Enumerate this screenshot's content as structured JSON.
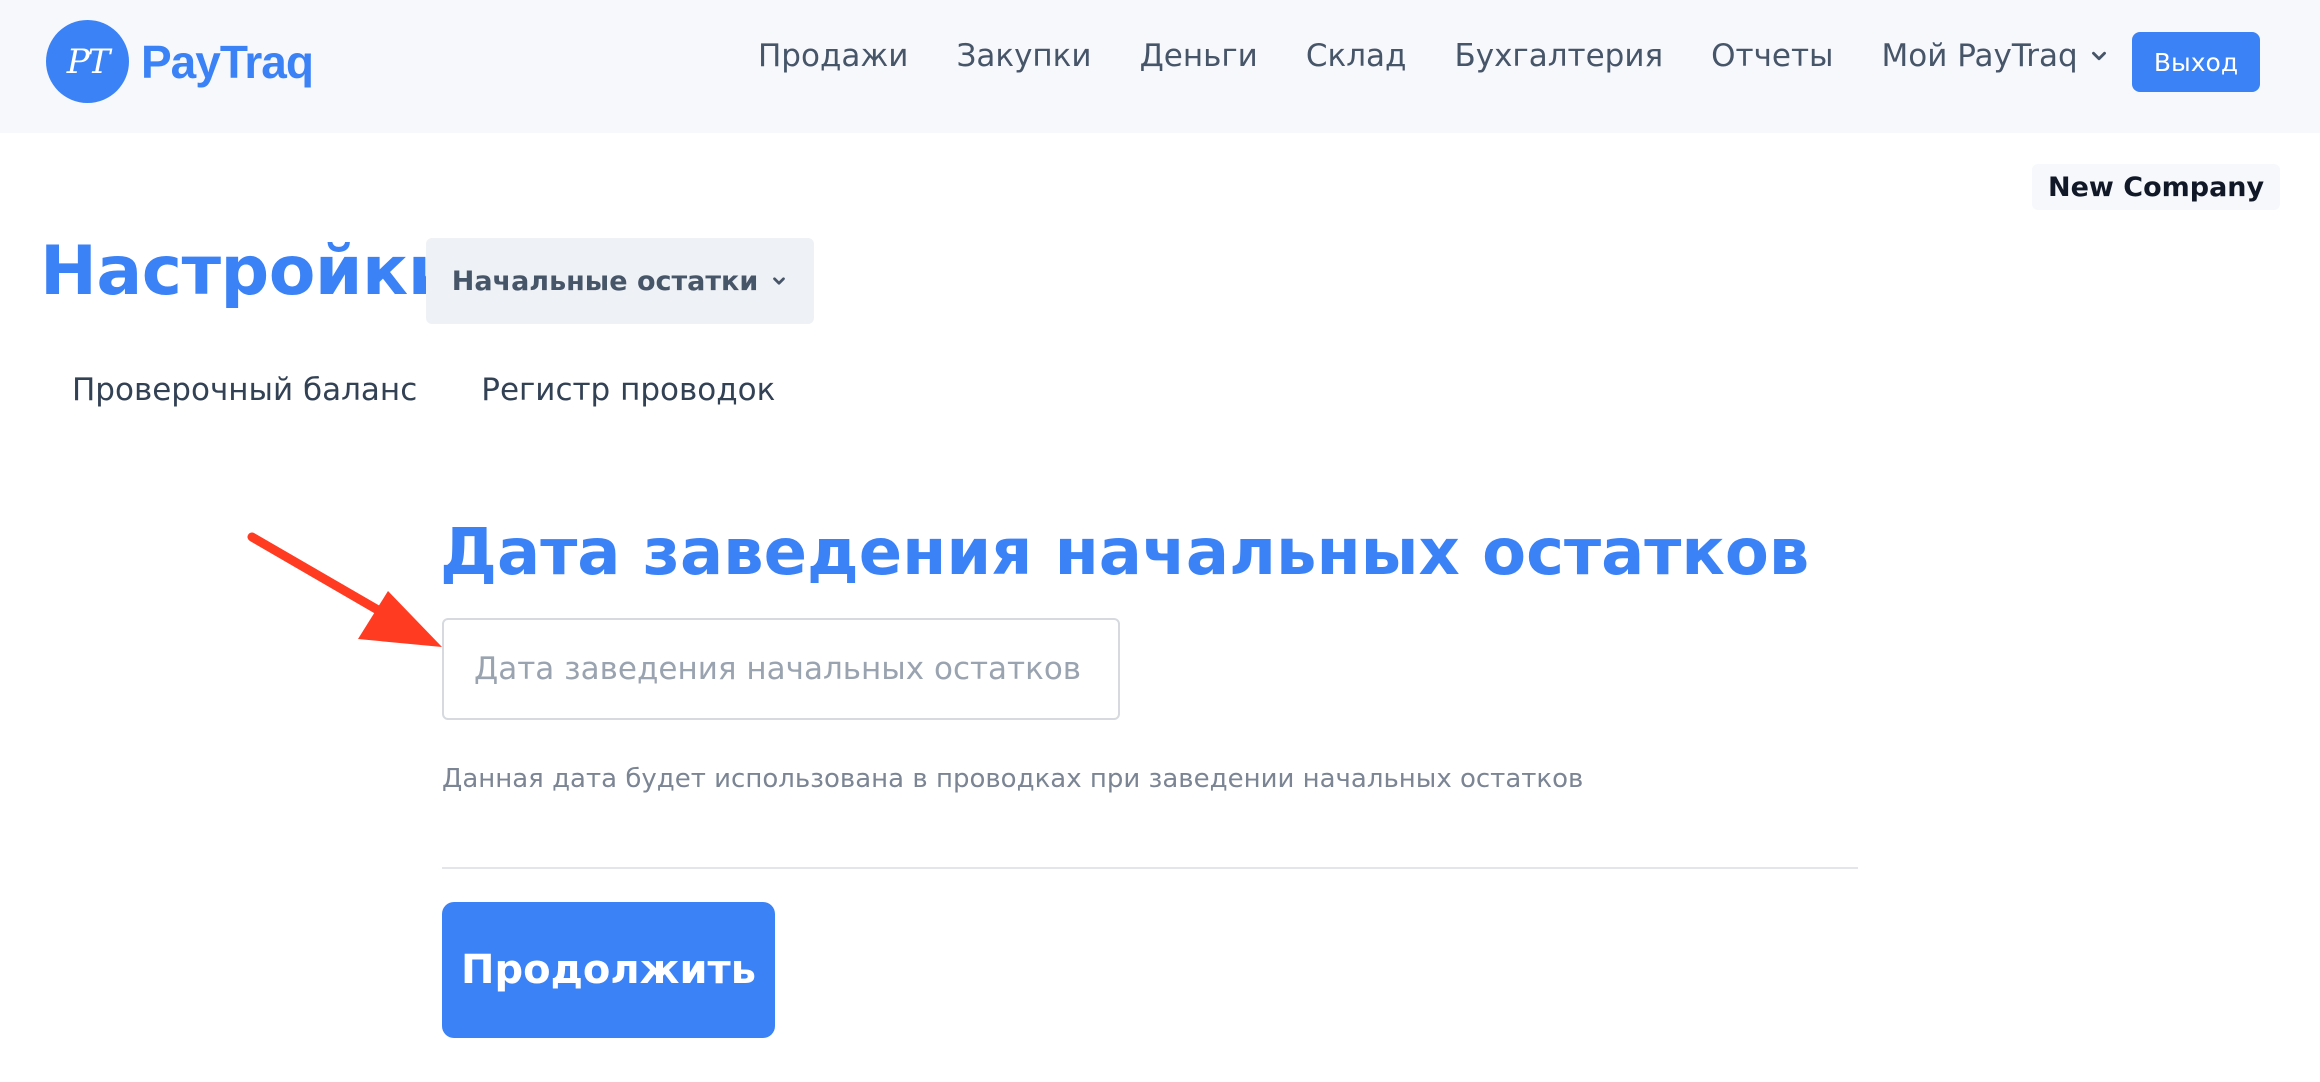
{
  "header": {
    "logo_mark": "PT",
    "logo_text": "PayTraq",
    "nav": [
      "Продажи",
      "Закупки",
      "Деньги",
      "Склад",
      "Бухгалтерия",
      "Отчеты"
    ],
    "nav_dropdown": "Мой PayTraq",
    "logout_label": "Выход"
  },
  "company_name": "New Company",
  "page_title": "Настройки",
  "section_dropdown": "Начальные остатки",
  "tabs": [
    "Проверочный баланс",
    "Регистр проводок"
  ],
  "form": {
    "heading": "Дата заведения начальных остатков",
    "date_placeholder": "Дата заведения начальных остатков",
    "date_value": "",
    "help_text": "Данная дата будет использована в проводках при заведении начальных остатков",
    "continue_label": "Продолжить"
  },
  "colors": {
    "accent": "#3b82f6",
    "annotation_arrow": "#ff3b22",
    "header_bg": "#f7f8fc"
  },
  "icons": {
    "nav_dropdown": "chevron-down-icon",
    "section_dropdown": "chevron-down-icon",
    "annotation": "arrow-annotation-icon"
  }
}
